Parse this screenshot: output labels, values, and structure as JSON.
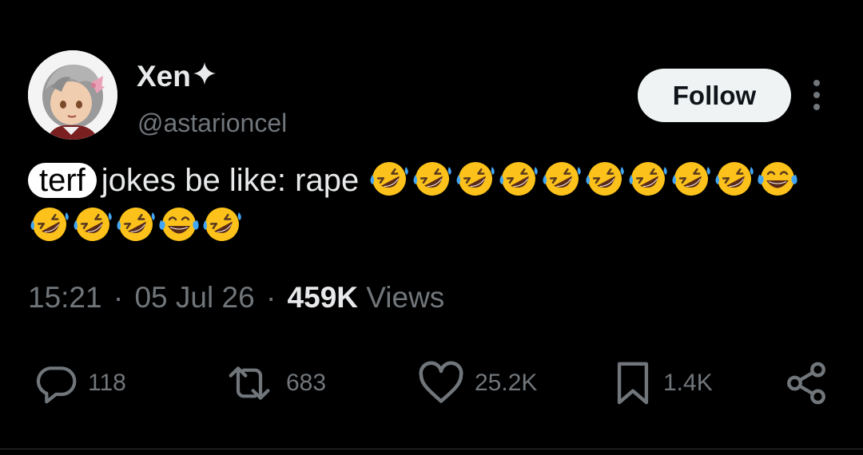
{
  "author": {
    "display_name": "Xen",
    "handle": "@astarioncel",
    "name_icon": "sparkle-icon",
    "avatar_icon": "figurine-avatar"
  },
  "follow_button": {
    "label": "Follow"
  },
  "more_menu": {
    "icon": "more-vertical-icon"
  },
  "tweet": {
    "highlight_word": "terf",
    "text": "jokes be like: rape",
    "emoji_sequence": [
      "rolling-on-floor-laughing",
      "rolling-on-floor-laughing",
      "rolling-on-floor-laughing",
      "rolling-on-floor-laughing",
      "rolling-on-floor-laughing",
      "rolling-on-floor-laughing",
      "rolling-on-floor-laughing",
      "rolling-on-floor-laughing",
      "rolling-on-floor-laughing",
      "face-with-tears-of-joy",
      "rolling-on-floor-laughing",
      "rolling-on-floor-laughing",
      "rolling-on-floor-laughing",
      "face-with-tears-of-joy",
      "rolling-on-floor-laughing"
    ]
  },
  "meta": {
    "time": "15:21",
    "date": "05 Jul 26",
    "separator": "·",
    "views_count": "459K",
    "views_label": "Views"
  },
  "actions": {
    "reply": {
      "icon": "reply-icon",
      "count": "118"
    },
    "repost": {
      "icon": "repost-icon",
      "count": "683"
    },
    "like": {
      "icon": "heart-icon",
      "count": "25.2K"
    },
    "bookmark": {
      "icon": "bookmark-icon",
      "count": "1.4K"
    },
    "share": {
      "icon": "share-icon"
    }
  },
  "colors": {
    "background": "#000000",
    "primary_text": "#e7e9ea",
    "secondary_text": "#71767b",
    "follow_bg": "#eff3f4",
    "follow_text": "#0f1419",
    "emoji_yellow": "#fcc21b",
    "emoji_tear": "#43a6f5"
  }
}
